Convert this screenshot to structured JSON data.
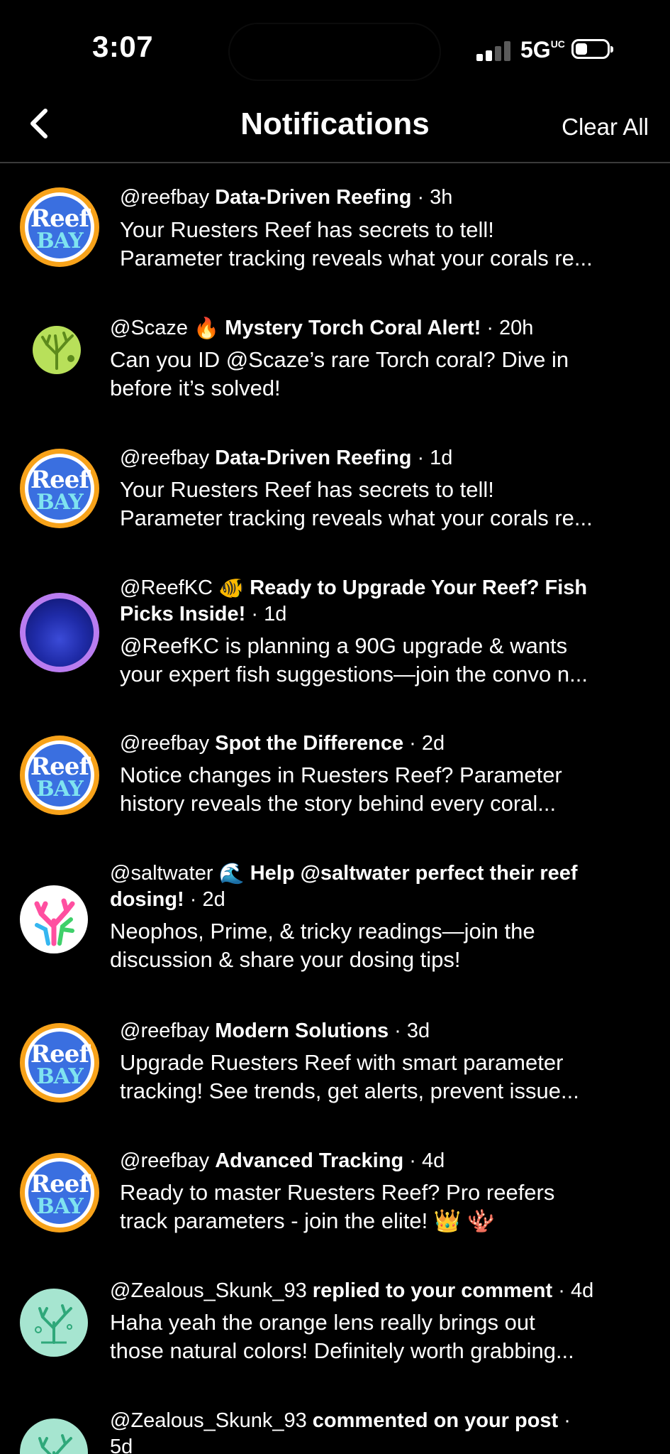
{
  "status_bar": {
    "time": "3:07",
    "network": "5G",
    "network_sup": "UC"
  },
  "header": {
    "title": "Notifications",
    "clear_all": "Clear All"
  },
  "notifications": [
    {
      "user": "@reefbay",
      "title": "Data-Driven Reefing",
      "ago": "· 3h",
      "line1": "Your Ruesters Reef has secrets to tell!",
      "line2": "Parameter tracking reveals what your corals re..."
    },
    {
      "user": "@Scaze",
      "emoji": "🔥",
      "title": "Mystery Torch Coral Alert!",
      "ago": " · 20h",
      "line1": "Can you ID @Scaze’s rare Torch coral? Dive in",
      "line2": "before it’s solved!"
    },
    {
      "user": "@reefbay",
      "title": "Data-Driven Reefing",
      "ago": "· 1d",
      "line1": "Your Ruesters Reef has secrets to tell!",
      "line2": "Parameter tracking reveals what your corals re..."
    },
    {
      "user": "@ReefKC",
      "emoji": "🐠",
      "title_a": "Ready to Upgrade Your Reef? Fish",
      "title_b": "Picks Inside!",
      "ago": "· 1d",
      "line1": "@ReefKC is planning a 90G upgrade & wants",
      "line2": "your expert fish suggestions—join the convo n..."
    },
    {
      "user": "@reefbay",
      "title": "Spot the Difference",
      "ago": "· 2d",
      "line1": "Notice changes in Ruesters Reef? Parameter",
      "line2": "history reveals the story behind every coral..."
    },
    {
      "user": "@saltwater",
      "emoji": "🌊",
      "title_a": "Help @saltwater perfect their reef",
      "title_b": "dosing!",
      "ago": "· 2d",
      "line1": "Neophos, Prime, & tricky readings—join the",
      "line2": "discussion & share your dosing tips!"
    },
    {
      "user": "@reefbay",
      "title": "Modern Solutions",
      "ago": "· 3d",
      "line1": "Upgrade Ruesters Reef with smart parameter",
      "line2": "tracking! See trends, get alerts, prevent issue..."
    },
    {
      "user": "@reefbay",
      "title": "Advanced Tracking",
      "ago": "· 4d",
      "line1": "Ready to master Ruesters Reef? Pro reefers",
      "line2": "track parameters - join the elite! 👑 🪸"
    },
    {
      "user": "@Zealous_Skunk_93",
      "title": "replied to your comment",
      "ago": "· 4d",
      "line1": "Haha yeah the orange lens really brings out",
      "line2": "those natural colors! Definitely worth grabbing..."
    },
    {
      "user": "@Zealous_Skunk_93",
      "title": "commented on your post",
      "ago": "·",
      "ago2": "5d"
    }
  ],
  "avatar_text": {
    "reef_top": "Reef",
    "reef_bottom": "BAY"
  },
  "colors": {
    "background": "#000000",
    "text": "#ffffff",
    "reefbay_ring": "#f7a21a",
    "reefbay_fill": "#3a6fe0"
  }
}
